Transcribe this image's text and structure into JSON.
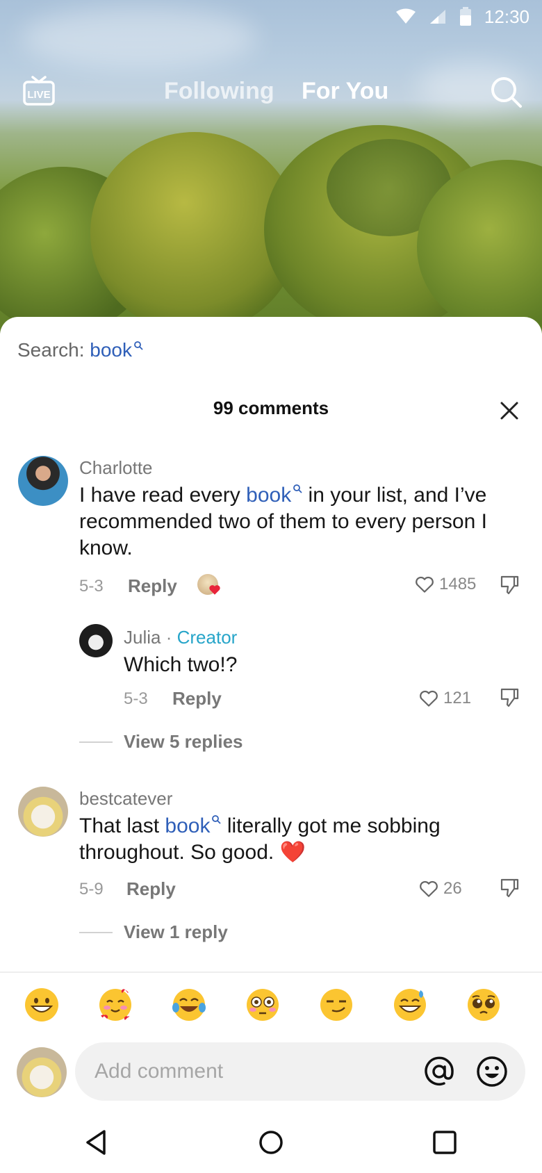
{
  "status_bar": {
    "time": "12:30"
  },
  "top_nav": {
    "live_label": "LIVE",
    "tab_following": "Following",
    "tab_for_you": "For You"
  },
  "sheet": {
    "search_prefix": "Search:",
    "search_keyword": "book",
    "comments_count": "99 comments"
  },
  "comments": [
    {
      "username": "Charlotte",
      "text_before": "I have read every",
      "keyword": "book",
      "text_after": "in your list, and I’ve recommended two of them to every person I know.",
      "date": "5-3",
      "reply_label": "Reply",
      "likes": "1485"
    },
    {
      "username": "Julia",
      "separator": "·",
      "badge": "Creator",
      "text": "Which two!?",
      "date": "5-3",
      "reply_label": "Reply",
      "likes": "121",
      "view_replies": "View 5 replies"
    },
    {
      "username": "bestcatever",
      "text_before": "That last",
      "keyword": "book",
      "text_after": "literally got me sobbing throughout. So good. ❤️",
      "date": "5-9",
      "reply_label": "Reply",
      "likes": "26",
      "view_replies": "View 1 reply"
    }
  ],
  "emoji_bar": [
    "grinning",
    "smiling-hearts",
    "tears-of-joy",
    "flushed",
    "smirk",
    "sweat-smile",
    "pleading"
  ],
  "composer": {
    "placeholder": "Add comment"
  },
  "colors": {
    "keyword": "#2f5fb8",
    "creator": "#27a5c9",
    "heart": "#e8243a"
  }
}
